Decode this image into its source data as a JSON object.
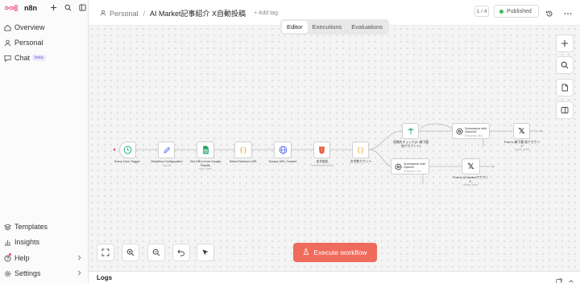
{
  "brand": {
    "name": "n8n"
  },
  "sidebar": {
    "top_items": [
      {
        "label": "Overview",
        "icon": "home-icon"
      },
      {
        "label": "Personal",
        "icon": "user-icon"
      },
      {
        "label": "Chat",
        "icon": "chat-icon",
        "badge": "beta"
      }
    ],
    "bottom_items": [
      {
        "label": "Templates",
        "icon": "templates-icon"
      },
      {
        "label": "Insights",
        "icon": "insights-icon"
      },
      {
        "label": "Help",
        "icon": "help-icon"
      },
      {
        "label": "Settings",
        "icon": "gear-icon"
      }
    ]
  },
  "header": {
    "project": "Personal",
    "workflow_title": "AI Market記事紹介 X自動投稿",
    "add_tag": "+ Add tag",
    "pager": "1 / 4",
    "status": "Published"
  },
  "tabs": [
    {
      "label": "Editor",
      "active": true
    },
    {
      "label": "Executions",
      "active": false
    },
    {
      "label": "Evaluations",
      "active": false
    }
  ],
  "execute_button": "Execute workflow",
  "logs": {
    "label": "Logs"
  },
  "nodes": [
    {
      "id": "n1",
      "label": "Every Hour Trigger",
      "sub": "",
      "icon": "clock-icon"
    },
    {
      "id": "n2",
      "label": "Workflow Configuration",
      "sub": "manual",
      "icon": "pen-icon"
    },
    {
      "id": "n3",
      "label": "Get URLs from Google Sheets",
      "sub": "read: sheet",
      "icon": "sheets-icon"
    },
    {
      "id": "n4",
      "label": "Select Random URL",
      "sub": "",
      "icon": "code-icon"
    },
    {
      "id": "n5",
      "label": "Scrape URL Content",
      "sub": "",
      "icon": "globe-icon"
    },
    {
      "id": "n6",
      "label": "本文抽出",
      "sub": "extractHtmlContent",
      "icon": "html-icon"
    },
    {
      "id": "n7",
      "label": "文字数カウント",
      "sub": "",
      "icon": "code-icon"
    },
    {
      "id": "n8",
      "label": "投稿先チェック(X: 森下優 宛アカウント)",
      "sub": "",
      "icon": "filter-icon"
    },
    {
      "id": "n9",
      "label": "Summarize with OpenAI1",
      "sub": "Response: Text",
      "icon": "openai-icon"
    },
    {
      "id": "n10",
      "label": "Summarize with OpenAI",
      "sub": "Response: Text",
      "icon": "openai-icon"
    },
    {
      "id": "n11",
      "label": "Post to 森下優 宛アカウント",
      "sub": "create: tweet",
      "icon": "x-icon"
    },
    {
      "id": "n12",
      "label": "Post to AI Marketアカウント",
      "sub": "create: tweet",
      "icon": "x-icon"
    }
  ]
}
